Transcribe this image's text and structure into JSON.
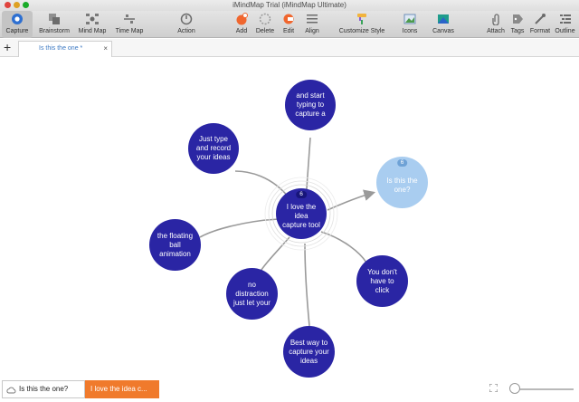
{
  "window": {
    "title": "iMindMap Trial (iMindMap Ultimate)"
  },
  "toolbar": {
    "items": [
      {
        "label": "Capture",
        "icon": "capture-icon"
      },
      {
        "label": "Brainstorm",
        "icon": "brainstorm-icon"
      },
      {
        "label": "Mind Map",
        "icon": "mind-map-icon"
      },
      {
        "label": "Time Map",
        "icon": "time-map-icon"
      },
      {
        "label": "Action",
        "icon": "action-icon"
      },
      {
        "label": "Add",
        "icon": "add-icon"
      },
      {
        "label": "Delete",
        "icon": "delete-icon"
      },
      {
        "label": "Edit",
        "icon": "edit-icon"
      },
      {
        "label": "Align",
        "icon": "align-icon"
      },
      {
        "label": "Customize Style",
        "icon": "paint-roller-icon"
      },
      {
        "label": "Icons",
        "icon": "image-icon"
      },
      {
        "label": "Canvas",
        "icon": "canvas-icon"
      },
      {
        "label": "Attach",
        "icon": "paperclip-icon"
      },
      {
        "label": "Tags",
        "icon": "tag-icon"
      },
      {
        "label": "Format",
        "icon": "format-icon"
      },
      {
        "label": "Outline",
        "icon": "outline-icon"
      }
    ]
  },
  "tabs": {
    "add": "+",
    "current": "Is this the one *",
    "close": "×"
  },
  "map": {
    "nodes": {
      "center": {
        "text": "I love the idea capture tool",
        "badge": "6"
      },
      "top": {
        "text": "and start typing to capture a"
      },
      "upper_left": {
        "text": "Just type and record your ideas"
      },
      "left": {
        "text": "the floating ball animation"
      },
      "lower_left": {
        "text": "no distraction just let your"
      },
      "bottom": {
        "text": "Best way to capture your ideas"
      },
      "right": {
        "text": "You don't have to click"
      },
      "selected": {
        "text": "Is this the one?",
        "badge": "6"
      }
    },
    "colors": {
      "node": "#2a25a4",
      "selected": "#a9cdf0",
      "branch": "#9a9a9a"
    }
  },
  "footer": {
    "crumbs": [
      "Is this the one?",
      "I love the idea c..."
    ],
    "crumb_icon": "cloud-icon",
    "fit_icon": "fit-screen-icon"
  }
}
